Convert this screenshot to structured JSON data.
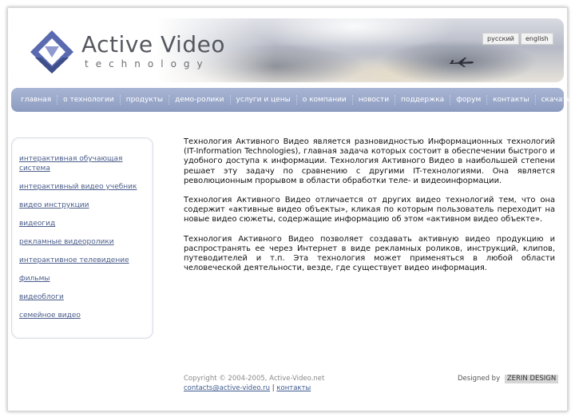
{
  "header": {
    "logo_title": "Active Video",
    "logo_subtitle": "technology",
    "languages": [
      "русский",
      "english"
    ]
  },
  "nav": {
    "items": [
      "главная",
      "о технологии",
      "продукты",
      "демо-ролики",
      "услуги и цены",
      "о компании",
      "новости",
      "поддержка",
      "форум",
      "контакты",
      "скачать"
    ]
  },
  "sidebar": {
    "links": [
      "интерактивная обучающая система",
      "интерактивный видео учебник",
      "видео инструкции",
      "видеогид",
      "рекламные видеоролики",
      "интерактивное телевидение",
      "фильмы",
      "видеоблоги",
      "семейное видео"
    ]
  },
  "main": {
    "paragraphs": [
      "Технология Активного Видео является разновидностью Информационных технологий (IT-Information Technologies), главная задача которых состоит в обеспечении быстрого и удобного доступа к информации. Технология Активного Видео в наибольшей степени решает эту задачу по сравнению с другими IT-технологиями. Она является революционным прорывом в области обработки теле- и видеоинформации.",
      "Технология Активного Видео отличается от других видео технологий тем, что она содержит «активные видео объекты», кликая по которым пользователь переходит на новые видео сюжеты, содержащие информацию об этом «активном видео объекте».",
      "Технология Активного Видео позволяет создавать активную видео продукцию и распространять ее через Интернет в виде рекламных роликов, инструкций, клипов, путеводителей и т.п. Эта технология может применяться в любой области человеческой деятельности, везде, где существует видео информация."
    ]
  },
  "footer": {
    "copyright": "Copyright © 2004-2005, Active-Video.net",
    "email": "contacts@active-video.ru",
    "separator": "|",
    "contacts_link": "контакты",
    "designed_by": "Designed by",
    "designer": "ZERIN DESIGN"
  },
  "colors": {
    "nav_bg": "#8c9cc1",
    "link": "#4a5d8a",
    "logo_blue": "#3f4f8c"
  }
}
